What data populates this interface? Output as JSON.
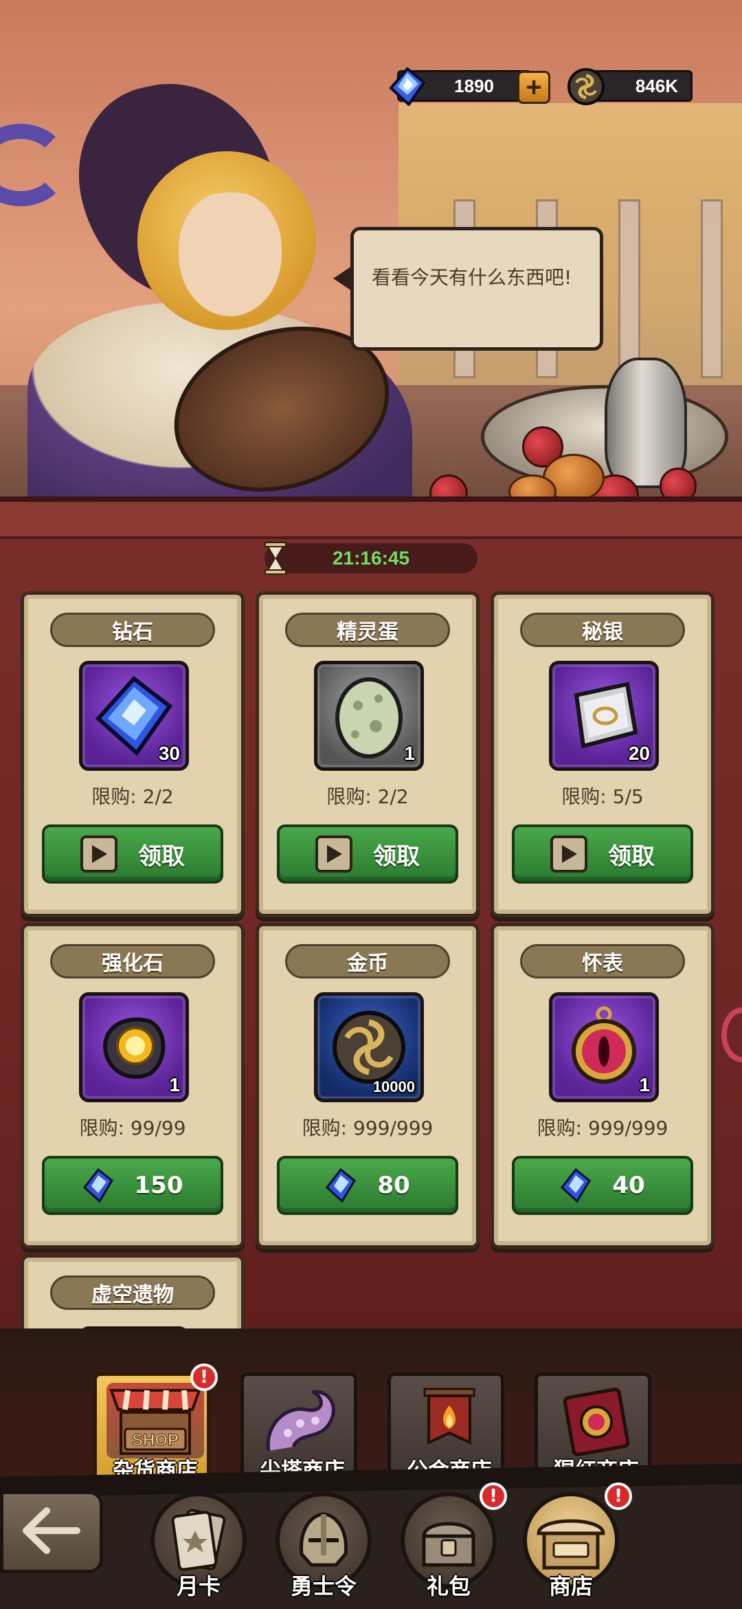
{
  "currency": {
    "gems": "1890",
    "gold": "846K",
    "plus": "+"
  },
  "npc": {
    "speech": "看看今天有什么东西吧!"
  },
  "timer": "21:16:45",
  "items": [
    {
      "name": "钻石",
      "qty": "30",
      "limit": "限购: 2/2",
      "btn": "领取",
      "icon": "diamond-icon"
    },
    {
      "name": "精灵蛋",
      "qty": "1",
      "limit": "限购: 2/2",
      "btn": "领取",
      "icon": "elf-egg-icon"
    },
    {
      "name": "秘银",
      "qty": "20",
      "limit": "限购: 5/5",
      "btn": "领取",
      "icon": "mithril-icon"
    },
    {
      "name": "强化石",
      "qty": "1",
      "limit": "限购: 99/99",
      "price": "150",
      "icon": "enhance-stone-icon"
    },
    {
      "name": "金币",
      "qty": "10000",
      "limit": "限购: 999/999",
      "price": "80",
      "icon": "gold-coin-icon"
    },
    {
      "name": "怀表",
      "qty": "1",
      "limit": "限购: 999/999",
      "price": "40",
      "icon": "pocket-watch-icon"
    },
    {
      "name": "虚空遗物"
    }
  ],
  "shop_tabs": [
    {
      "label": "杂货商店",
      "sign": "SHOP",
      "badge": "!"
    },
    {
      "label": "尖塔商店"
    },
    {
      "label": "公会商店"
    },
    {
      "label": "猩红商店"
    }
  ],
  "nav": [
    {
      "label": "月卡"
    },
    {
      "label": "勇士令"
    },
    {
      "label": "礼包",
      "badge": "!"
    },
    {
      "label": "商店",
      "badge": "!"
    }
  ],
  "colors": {
    "timer": "#6ee063",
    "button_green": "#3a9a3e",
    "card_bg": "#e2d2ad",
    "panel_red": "#7a2e2a",
    "badge_red": "#d82a2a"
  }
}
